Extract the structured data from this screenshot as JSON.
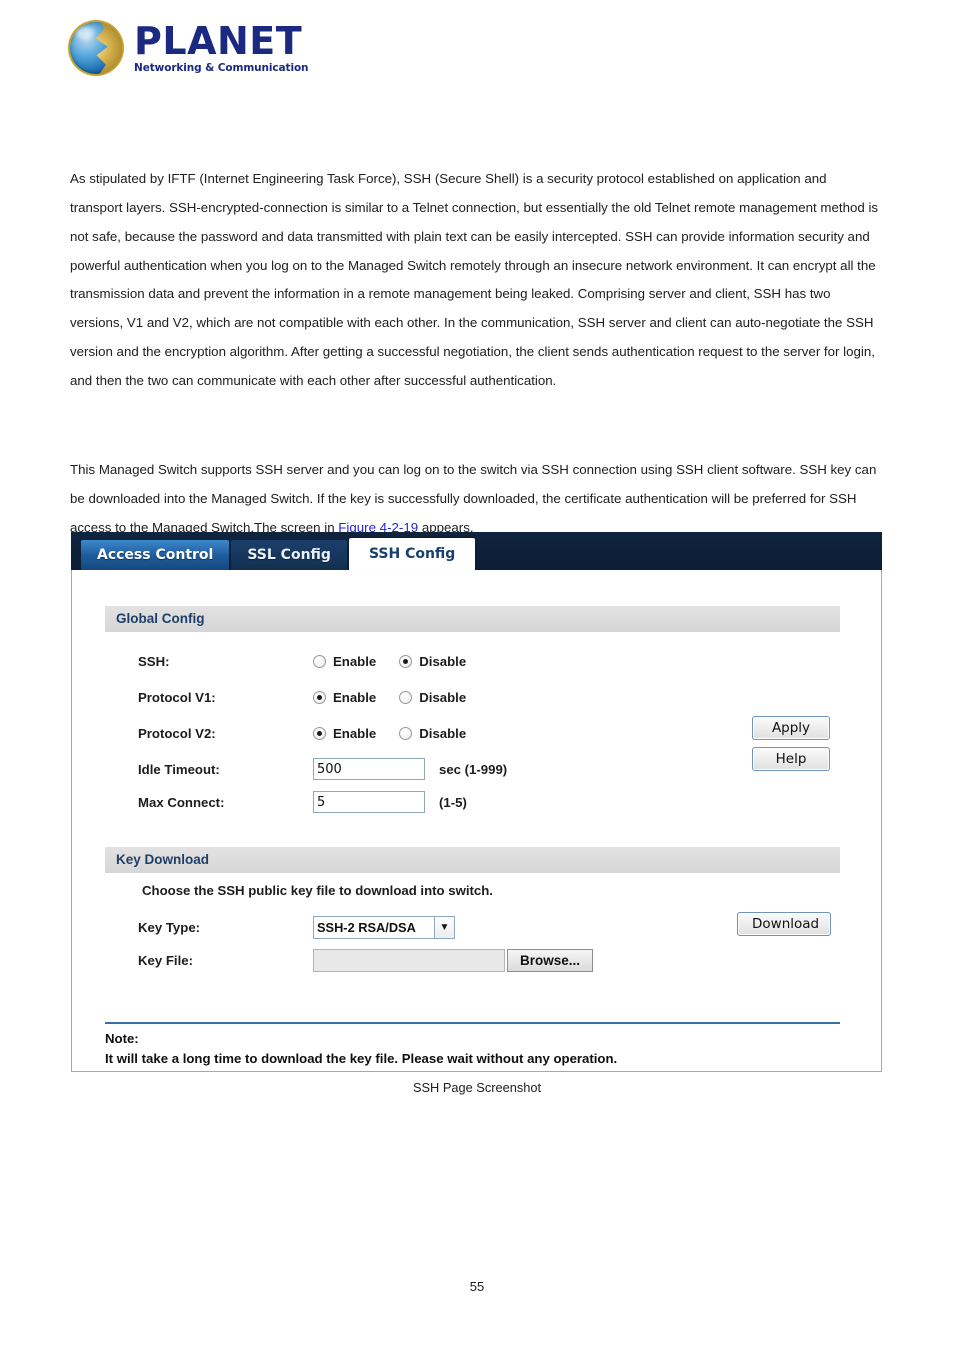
{
  "brand": {
    "name": "PLANET",
    "tagline": "Networking & Communication",
    "logo_icon": "planet-globe-icon",
    "brand_color": "#1b2a80"
  },
  "document": {
    "paragraph_1": "As stipulated by IFTF (Internet Engineering Task Force), SSH (Secure Shell) is a security protocol established on application and transport layers. SSH-encrypted-connection is similar to a Telnet connection, but essentially the old Telnet remote management method is not safe, because the password and data transmitted with plain text can be easily intercepted. SSH can provide information security and powerful authentication when you log on to the Managed Switch remotely through an insecure network environment. It can encrypt all the transmission data and prevent the information in a remote management being leaked. Comprising server and client, SSH has two versions, V1 and V2, which are not compatible with each other. In the communication, SSH server and client can auto-negotiate the SSH version and the encryption algorithm. After getting a successful negotiation, the client sends authentication request to the server for login, and then the two can communicate with each other after successful authentication.",
    "paragraph_2_before_link": "This Managed Switch supports SSH server and you can log on to the switch via SSH connection using SSH client software. SSH key can be downloaded into the Managed Switch. If the key is successfully downloaded, the certificate authentication will be preferred for SSH access to the Managed Switch.The screen in ",
    "figure_link": "Figure 4-2-19",
    "figure_link_color": "#2222dd",
    "paragraph_2_after_link": " appears.",
    "caption": "SSH Page Screenshot",
    "page_number": "55"
  },
  "switch_ui": {
    "tabs": [
      {
        "label": "Access Control",
        "state": "inactive-light"
      },
      {
        "label": "SSL Config",
        "state": "inactive-dark"
      },
      {
        "label": "SSH Config",
        "state": "active"
      }
    ],
    "global_config": {
      "section_title": "Global Config",
      "rows": [
        {
          "label": "SSH:",
          "enable_label": "Enable",
          "disable_label": "Disable",
          "selected": "Disable"
        },
        {
          "label": "Protocol V1:",
          "enable_label": "Enable",
          "disable_label": "Disable",
          "selected": "Enable"
        },
        {
          "label": "Protocol V2:",
          "enable_label": "Enable",
          "disable_label": "Disable",
          "selected": "Enable"
        }
      ],
      "idle_timeout": {
        "label": "Idle Timeout:",
        "value": "500",
        "hint": "sec (1-999)"
      },
      "max_connect": {
        "label": "Max Connect:",
        "value": "5",
        "hint": "(1-5)"
      },
      "apply_button": "Apply",
      "help_button": "Help"
    },
    "key_download": {
      "section_title": "Key Download",
      "helper_text": "Choose the SSH public key file to download into switch.",
      "key_type": {
        "label": "Key Type:",
        "selected": "SSH-2 RSA/DSA",
        "arrow_icon": "chevron-down-icon"
      },
      "key_file": {
        "label": "Key File:",
        "value": "",
        "browse_button": "Browse..."
      },
      "download_button": "Download"
    },
    "note": {
      "title": "Note:",
      "text": "It will take a long time to download the key file. Please wait without any operation.",
      "rule_color": "#3a6ea5"
    }
  }
}
